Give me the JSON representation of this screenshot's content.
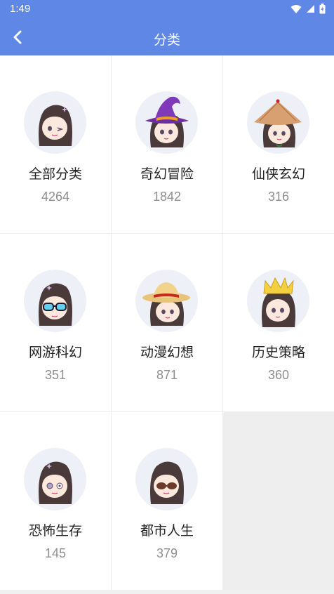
{
  "status_bar": {
    "time": "1:49"
  },
  "header": {
    "title": "分类",
    "back_icon": "chevron-left-icon",
    "color": "#5f87e6"
  },
  "categories": [
    {
      "name": "全部分类",
      "count": "4264",
      "avatar_icon": "girl-avatar-icon"
    },
    {
      "name": "奇幻冒险",
      "count": "1842",
      "avatar_icon": "witch-hat-girl-avatar-icon"
    },
    {
      "name": "仙侠玄幻",
      "count": "316",
      "avatar_icon": "bamboo-hat-girl-avatar-icon"
    },
    {
      "name": "网游科幻",
      "count": "351",
      "avatar_icon": "goggles-girl-avatar-icon"
    },
    {
      "name": "动漫幻想",
      "count": "871",
      "avatar_icon": "straw-hat-girl-avatar-icon"
    },
    {
      "name": "历史策略",
      "count": "360",
      "avatar_icon": "crown-girl-avatar-icon"
    },
    {
      "name": "恐怖生存",
      "count": "145",
      "avatar_icon": "eyepatch-girl-avatar-icon"
    },
    {
      "name": "都市人生",
      "count": "379",
      "avatar_icon": "sunglasses-girl-avatar-icon"
    }
  ]
}
